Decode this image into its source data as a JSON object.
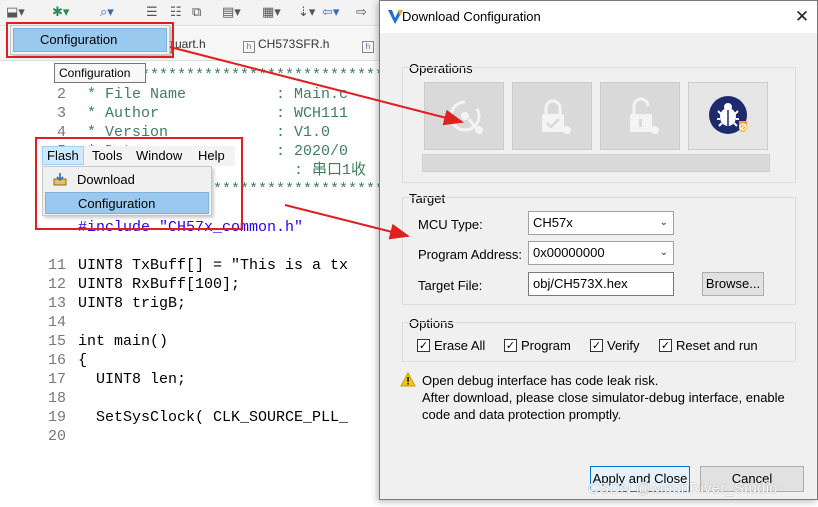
{
  "ide": {
    "tabs": [
      "uart.h",
      "CH573SFR.h"
    ],
    "code_lines": [
      {
        "num": "",
        "text": "/*******************************************************"
      },
      {
        "num": "2",
        "text": " * File Name          : Main.c"
      },
      {
        "num": "3",
        "text": " * Author             : WCH111"
      },
      {
        "num": "4",
        "text": " * Version            : V1.0"
      },
      {
        "num": "5",
        "text": " * Date               : 2020/0"
      },
      {
        "num": "",
        "text": "                        : 串口1收"
      },
      {
        "num": "",
        "text": "*******************************************************"
      },
      {
        "num": "",
        "text": "#include \"CH57x_common.h\""
      },
      {
        "num": "",
        "text": ""
      },
      {
        "num": "11",
        "text": "UINT8 TxBuff[] = \"This is a tx"
      },
      {
        "num": "12",
        "text": "UINT8 RxBuff[100];"
      },
      {
        "num": "13",
        "text": "UINT8 trigB;"
      },
      {
        "num": "14",
        "text": ""
      },
      {
        "num": "15",
        "text": "int main()"
      },
      {
        "num": "16",
        "text": "{"
      },
      {
        "num": "17",
        "text": "  UINT8 len;"
      },
      {
        "num": "18",
        "text": ""
      },
      {
        "num": "19",
        "text": "  SetSysClock( CLK_SOURCE_PLL_"
      },
      {
        "num": "20",
        "text": ""
      }
    ]
  },
  "top_menu": {
    "item_label": "Configuration",
    "tooltip": "Configuration"
  },
  "flash_menu": {
    "menubar": [
      "Flash",
      "Tools",
      "Window",
      "Help"
    ],
    "items": [
      "Download",
      "Configuration"
    ]
  },
  "dialog": {
    "title": "Download Configuration",
    "operations_label": "Operations",
    "operation_buttons": [
      "erase-chip-icon",
      "lock-chip-icon",
      "unlock-chip-icon",
      "debug-protect-icon"
    ],
    "target_label": "Target",
    "mcu_type_label": "MCU Type:",
    "mcu_type_value": "CH57x",
    "program_address_label": "Program Address:",
    "program_address_value": "0x00000000",
    "target_file_label": "Target File:",
    "target_file_value": "obj/CH573X.hex",
    "browse_label": "Browse...",
    "options_label": "Options",
    "options": [
      {
        "label": "Erase All",
        "checked": true
      },
      {
        "label": "Program",
        "checked": true
      },
      {
        "label": "Verify",
        "checked": true
      },
      {
        "label": "Reset and run",
        "checked": true
      }
    ],
    "warning_lines": [
      "Open debug interface has code leak risk.",
      "After download, please close simulator-debug interface, enable",
      "code and data protection promptly."
    ],
    "apply_label": "Apply and Close",
    "cancel_label": "Cancel"
  },
  "watermark": "CSDN @MounRiver_Studio",
  "colors": {
    "highlight_red": "#e02020",
    "menu_selection": "#99c9ef",
    "accent_blue": "#0078d7"
  }
}
